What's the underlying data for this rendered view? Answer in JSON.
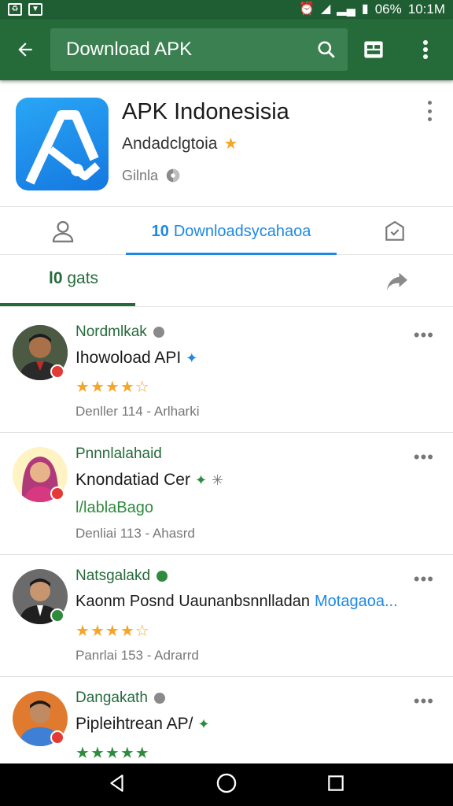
{
  "status_bar": {
    "battery": "06%",
    "time": "10:1M"
  },
  "toolbar": {
    "search_text": "Download APK"
  },
  "app": {
    "title": "APK Indonesisia",
    "developer": "Andadclgtoia",
    "category": "Gilnla",
    "icon_color": "#1e88e5"
  },
  "tabs": {
    "downloads_prefix": "10",
    "downloads_label": "Downloadsycahaoa"
  },
  "filter": {
    "prefix": "l0",
    "label": "gats"
  },
  "reviews": [
    {
      "name": "Nordmlkak",
      "text": "Ihowoload  API",
      "rating": 4,
      "meta": "Denller 114 - Arlharki",
      "badge_color": "#e53935"
    },
    {
      "name": "Pnnnlalahaid",
      "text": "Knondatiad  Cer",
      "green_line": "l/lablaBago",
      "meta": "Denliai 113 - Ahasrd",
      "badge_color": "#e53935"
    },
    {
      "name": "Natsgalakd",
      "text": "Kaonm Posnd  Uaunanbsnnlladan",
      "link": "Motagaoa...",
      "rating": 4,
      "meta": "Panrlai 153 - Adrarrd",
      "badge_color": "#2e8b3e"
    },
    {
      "name": "Dangakath",
      "text": "Pipleihtrean  AP/",
      "rating": 5,
      "meta": "",
      "badge_color": "#e53935"
    }
  ],
  "colors": {
    "accent_green": "#256b3a",
    "accent_blue": "#1e88e5",
    "star": "#f4a62a"
  }
}
